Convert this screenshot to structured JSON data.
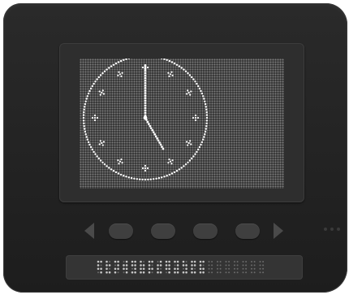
{
  "device": {
    "screen": {
      "display": "analog-clock",
      "clock": {
        "hour": 5,
        "minute": 0
      }
    },
    "nav": {
      "left": {
        "icon": "triangle-left-icon"
      },
      "right": {
        "icon": "triangle-right-icon"
      },
      "buttons": 4
    },
    "braille_display": {
      "cells": 20,
      "raised_cells": 13
    }
  },
  "colors": {
    "body": "#232323",
    "screen": "#3a3a3a",
    "pixel_off": "#7c7c7c",
    "pixel_on": "#ffffff",
    "button": "#3f3f3f",
    "arrow": "#4a4a4a"
  }
}
